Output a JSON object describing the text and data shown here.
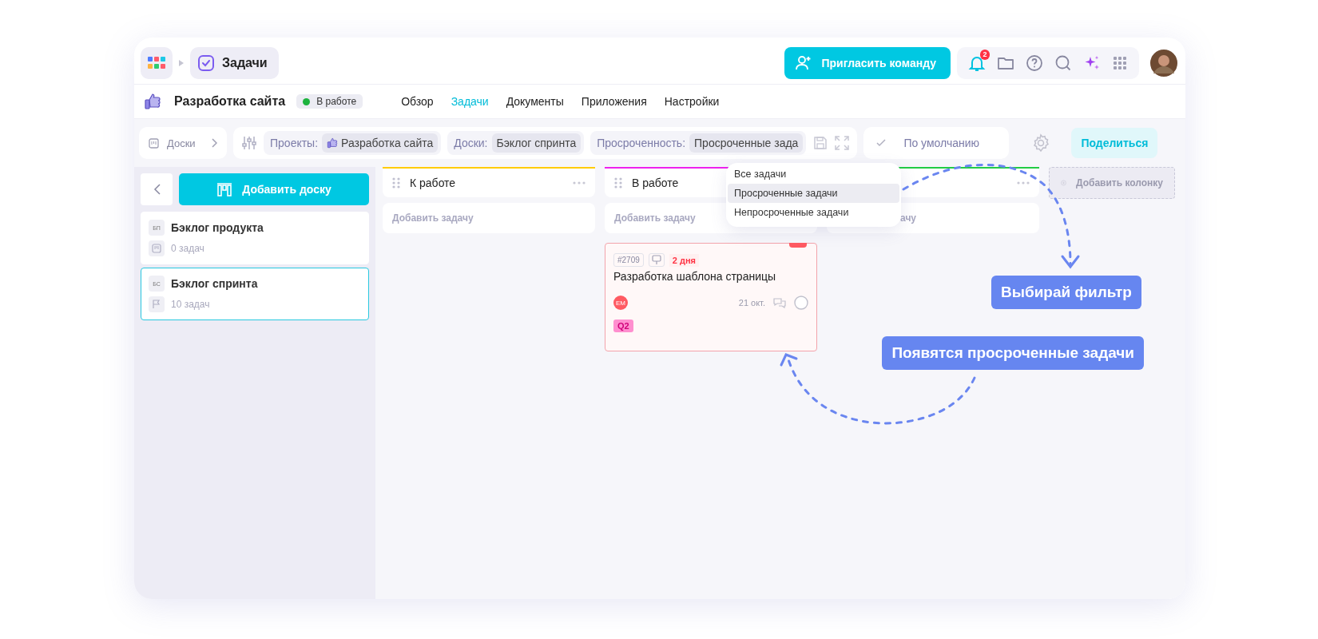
{
  "topbar": {
    "app_label": "Задачи",
    "invite_button": "Пригласить команду",
    "notifications_badge": "2"
  },
  "project": {
    "name": "Разработка сайта",
    "status": "В работе",
    "tabs": [
      {
        "label": "Обзор",
        "selected": false
      },
      {
        "label": "Задачи",
        "selected": true
      },
      {
        "label": "Документы",
        "selected": false
      },
      {
        "label": "Приложения",
        "selected": false
      },
      {
        "label": "Настройки",
        "selected": false
      }
    ]
  },
  "filters": {
    "boards_label": "Доски",
    "chips": [
      {
        "label": "Проекты:",
        "value": "Разработка сайта",
        "kind": "project"
      },
      {
        "label": "Доски:",
        "value": "Бэклог спринта",
        "kind": "plain"
      },
      {
        "label": "Просроченность:",
        "value": "Просроченные зада",
        "kind": "plain"
      }
    ],
    "sort": "По умолчанию",
    "share_button": "Поделиться"
  },
  "sidebar": {
    "add_board_button": "Добавить доску",
    "boards": [
      {
        "abbr": "БП",
        "name": "Бэклог продукта",
        "count": "0 задач",
        "selected": false,
        "kind": "list"
      },
      {
        "abbr": "БС",
        "name": "Бэклог спринта",
        "count": "10 задач",
        "selected": true,
        "kind": "sprint"
      }
    ]
  },
  "columns": [
    {
      "title": "К работе",
      "color": "#ffcc00",
      "add_task": "Добавить задачу"
    },
    {
      "title": "В работе",
      "color": "#ee22ee",
      "add_task": "Добавить задачу",
      "cards": [
        {
          "id": "#2709",
          "overdue": "2 дня",
          "title": "Разработка шаблона страницы",
          "assignee": "ЕМ",
          "date": "21 окт.",
          "tag": "Q2"
        }
      ]
    },
    {
      "color": "#22cc44",
      "add_task": "ачу"
    }
  ],
  "add_column": "Добавить колонку",
  "dropdown": {
    "options": [
      {
        "label": "Все задачи",
        "selected": false
      },
      {
        "label": "Просроченные задачи",
        "selected": true
      },
      {
        "label": "Непросроченные задачи",
        "selected": false
      }
    ]
  },
  "annotations": [
    "Выбирай фильтр",
    "Появятся просроченные задачи"
  ]
}
